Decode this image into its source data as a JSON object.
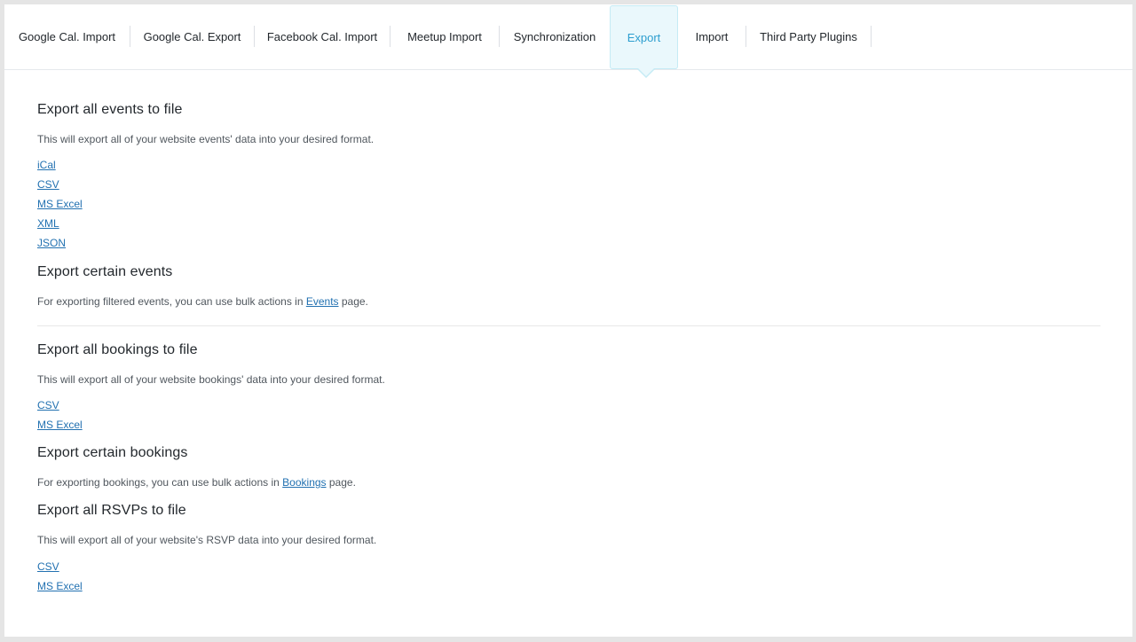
{
  "tabs": [
    {
      "label": "Google Cal. Import"
    },
    {
      "label": "Google Cal. Export"
    },
    {
      "label": "Facebook Cal. Import"
    },
    {
      "label": "Meetup Import"
    },
    {
      "label": "Synchronization"
    },
    {
      "label": "Export",
      "active": true
    },
    {
      "label": "Import"
    },
    {
      "label": "Third Party Plugins"
    }
  ],
  "events_export": {
    "title": "Export all events to file",
    "description": "This will export all of your website events' data into your desired format.",
    "formats": [
      "iCal",
      "CSV",
      "MS Excel",
      "XML",
      "JSON"
    ]
  },
  "certain_events": {
    "title": "Export certain events",
    "text_before": "For exporting filtered events, you can use bulk actions in ",
    "link": "Events",
    "text_after": " page."
  },
  "bookings_export": {
    "title": "Export all bookings to file",
    "description": "This will export all of your website bookings' data into your desired format.",
    "formats": [
      "CSV",
      "MS Excel"
    ]
  },
  "certain_bookings": {
    "title": "Export certain bookings",
    "text_before": "For exporting bookings, you can use bulk actions in ",
    "link": "Bookings",
    "text_after": " page."
  },
  "rsvps_export": {
    "title": "Export all RSVPs to file",
    "description": "This will export all of your website's RSVP data into your desired format.",
    "formats": [
      "CSV",
      "MS Excel"
    ]
  },
  "colors": {
    "active_tab_bg": "#eaf8fc",
    "active_tab_text": "#2c9ecf",
    "link": "#2271b1"
  }
}
